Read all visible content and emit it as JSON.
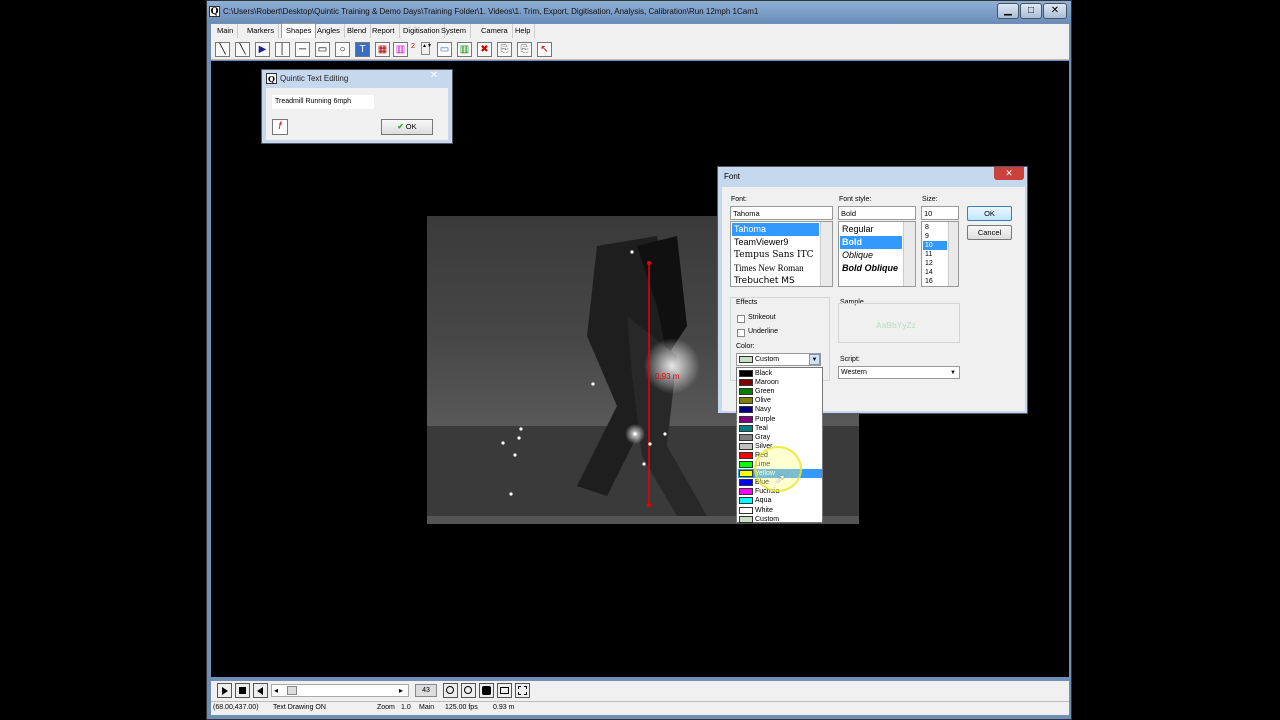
{
  "app": {
    "title": "C:\\Users\\Robert\\Desktop\\Quintic Training & Demo Days\\Training Folder\\1. Videos\\1. Trim, Export, Digitisation, Analysis, Calibration\\Run 12mph 1Cam1",
    "icon_letter": "Q"
  },
  "menu": [
    "Main",
    "Markers",
    "Shapes",
    "Angles",
    "Blend",
    "Report",
    "Digitisation",
    "System",
    "Camera",
    "Help"
  ],
  "toolbar": {
    "tools": [
      "line-tool",
      "diagonal-line-tool",
      "arrow-tool",
      "vertical-line-tool",
      "horizontal-line-tool",
      "rectangle-tool",
      "circle-tool",
      "text-tool",
      "grid-tool",
      "color-palette-tool",
      "line-width-stepper",
      "fill-tool",
      "palette-tool",
      "delete-tool",
      "paste-tool",
      "copy-tool",
      "pointer-tool"
    ],
    "line_width": "2"
  },
  "video": {
    "measurement": "0.93  m"
  },
  "text_dialog": {
    "title": "Quintic Text Editing",
    "text_value": "Treadmill Running 6mph",
    "ok": "OK"
  },
  "font_dialog": {
    "title": "Font",
    "font_label": "Font:",
    "font_value": "Tahoma",
    "fonts": [
      "Tahoma",
      "TeamViewer9",
      "Tempus Sans ITC",
      "Times New Roman",
      "Trebuchet MS"
    ],
    "style_label": "Font style:",
    "style_value": "Bold",
    "styles": [
      "Regular",
      "Bold",
      "Oblique",
      "Bold Oblique"
    ],
    "size_label": "Size:",
    "size_value": "10",
    "sizes": [
      "8",
      "9",
      "10",
      "11",
      "12",
      "14",
      "16"
    ],
    "ok": "OK",
    "cancel": "Cancel",
    "effects_label": "Effects",
    "strikeout": "Strikeout",
    "underline": "Underline",
    "color_label": "Color:",
    "color_value": "Custom",
    "sample_label": "Sample",
    "sample_text": "AaBbYyZz",
    "script_label": "Script:",
    "script_value": "Western"
  },
  "colors": [
    {
      "name": "Black",
      "hex": "#000000"
    },
    {
      "name": "Maroon",
      "hex": "#800000"
    },
    {
      "name": "Green",
      "hex": "#008000"
    },
    {
      "name": "Olive",
      "hex": "#808000"
    },
    {
      "name": "Navy",
      "hex": "#000080"
    },
    {
      "name": "Purple",
      "hex": "#800080"
    },
    {
      "name": "Teal",
      "hex": "#008080"
    },
    {
      "name": "Gray",
      "hex": "#808080"
    },
    {
      "name": "Silver",
      "hex": "#c0c0c0"
    },
    {
      "name": "Red",
      "hex": "#ff0000"
    },
    {
      "name": "Lime",
      "hex": "#00ff00"
    },
    {
      "name": "Yellow",
      "hex": "#ffff00"
    },
    {
      "name": "Blue",
      "hex": "#0000ff"
    },
    {
      "name": "Fuchsia",
      "hex": "#ff00ff"
    },
    {
      "name": "Aqua",
      "hex": "#00ffff"
    },
    {
      "name": "White",
      "hex": "#ffffff"
    },
    {
      "name": "Custom",
      "hex": "#c8e0c8"
    }
  ],
  "selected_color": "Yellow",
  "playback": {
    "frame": "43"
  },
  "status": {
    "coords": "(68.00,437.00)",
    "mode": "Text Drawing ON",
    "zoom_label": "Zoom",
    "zoom": "1.0",
    "view": "Main",
    "fps": "125.00 fps",
    "distance": "0.93  m"
  }
}
